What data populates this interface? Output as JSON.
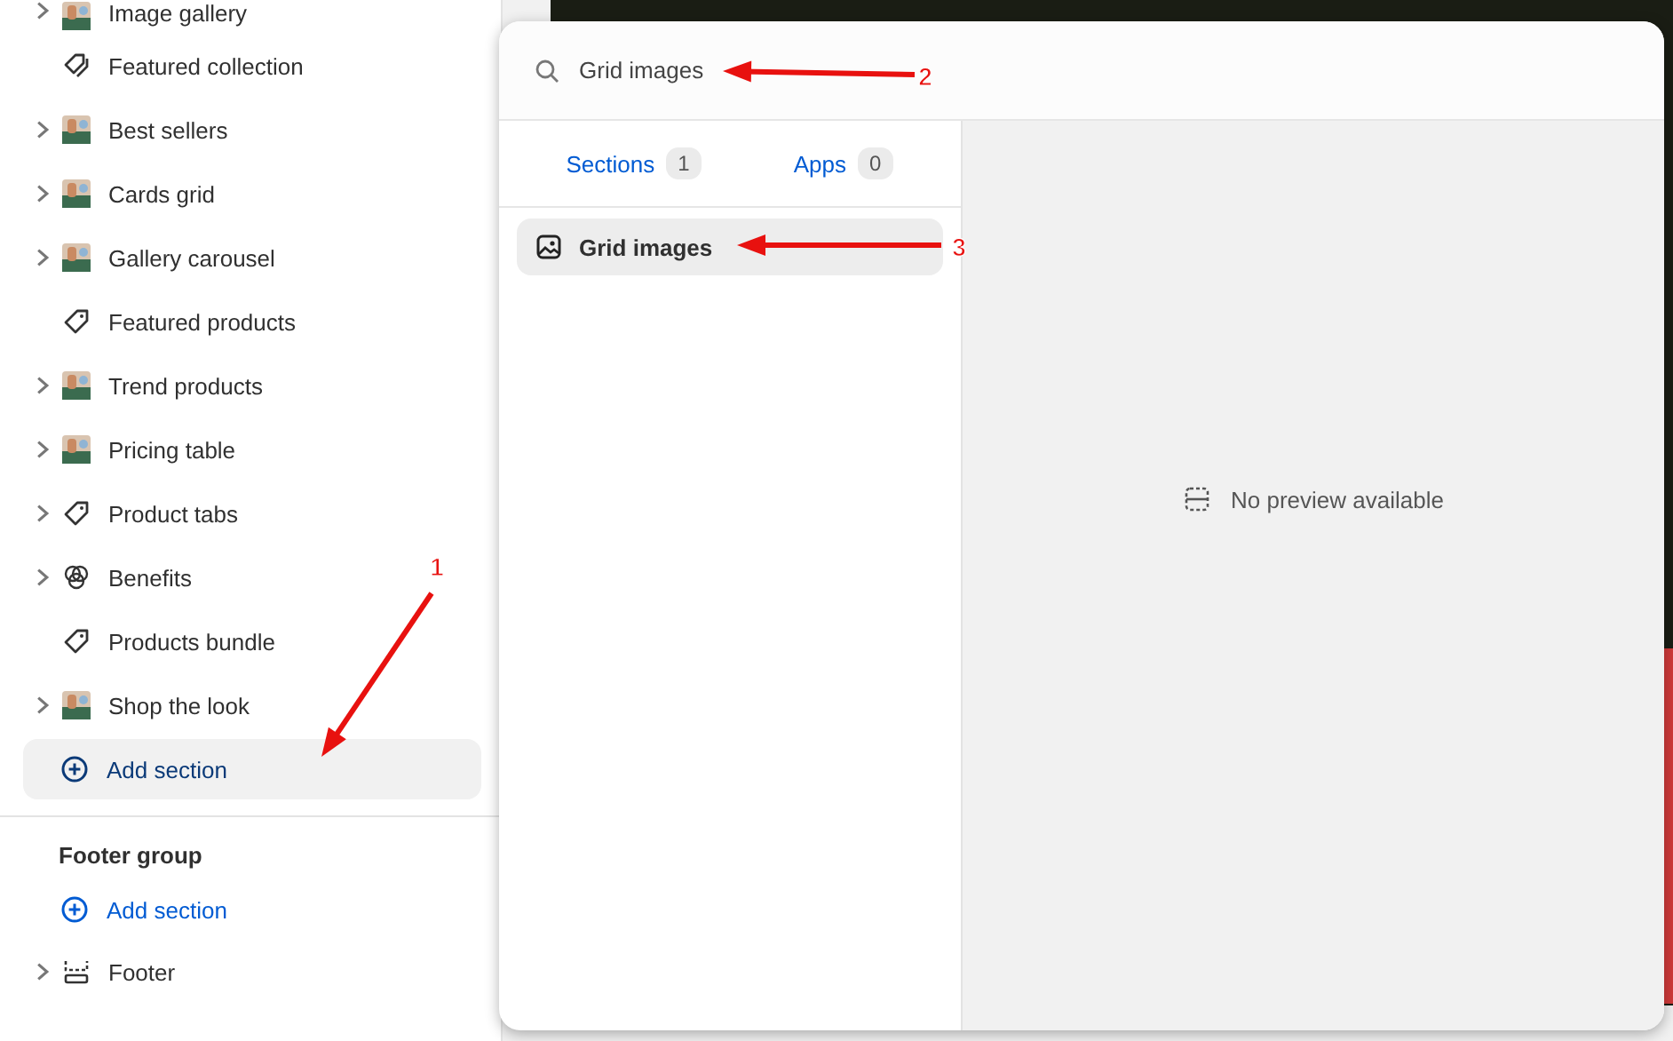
{
  "sidebar": {
    "items": [
      {
        "label": "Image gallery",
        "kind": "thumbnail",
        "expandable": true
      },
      {
        "label": "Featured collection",
        "kind": "tags",
        "expandable": false
      },
      {
        "label": "Best sellers",
        "kind": "thumbnail",
        "expandable": true
      },
      {
        "label": "Cards grid",
        "kind": "thumbnail",
        "expandable": true
      },
      {
        "label": "Gallery carousel",
        "kind": "thumbnail",
        "expandable": true
      },
      {
        "label": "Featured products",
        "kind": "tag",
        "expandable": false
      },
      {
        "label": "Trend products",
        "kind": "thumbnail",
        "expandable": true
      },
      {
        "label": "Pricing table",
        "kind": "thumbnail",
        "expandable": true
      },
      {
        "label": "Product tabs",
        "kind": "tag",
        "expandable": true
      },
      {
        "label": "Benefits",
        "kind": "benefits",
        "expandable": true
      },
      {
        "label": "Products bundle",
        "kind": "tag",
        "expandable": false
      },
      {
        "label": "Shop the look",
        "kind": "thumbnail",
        "expandable": true
      }
    ],
    "add_section": {
      "label": "Add section",
      "selected": true
    },
    "footer_group": {
      "title": "Footer group",
      "add_section": {
        "label": "Add section",
        "selected": false
      },
      "items": [
        {
          "label": "Footer",
          "kind": "footer",
          "expandable": true
        }
      ]
    }
  },
  "popup": {
    "search": {
      "value": "Grid images"
    },
    "tabs": [
      {
        "label": "Sections",
        "count": "1"
      },
      {
        "label": "Apps",
        "count": "0"
      }
    ],
    "results": [
      {
        "label": "Grid images",
        "selected": true
      }
    ],
    "preview": {
      "message": "No preview available"
    }
  },
  "annotations": [
    {
      "label": "1"
    },
    {
      "label": "2"
    },
    {
      "label": "3"
    }
  ]
}
